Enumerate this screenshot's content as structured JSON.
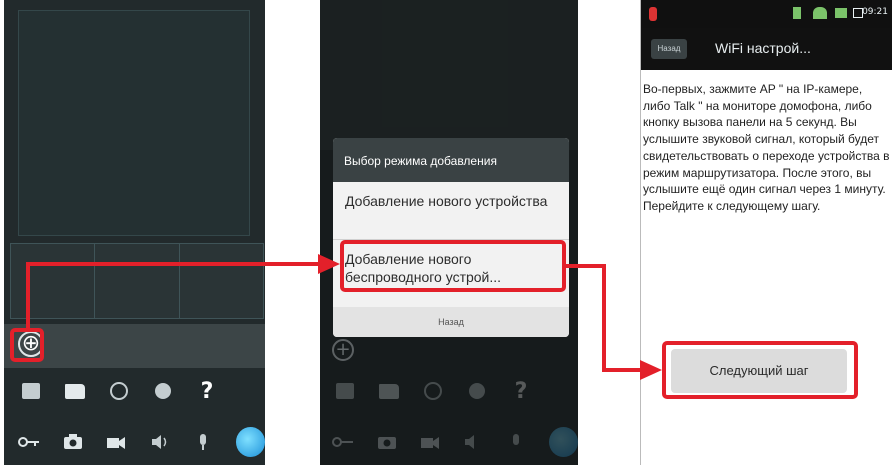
{
  "phone1": {
    "add_glyph": "⊕",
    "help_glyph": "?",
    "toolbar_row1_icons": [
      "list-icon",
      "folder-icon",
      "playback-icon",
      "gear-icon",
      "help-icon"
    ],
    "toolbar_row2_icons": [
      "key-icon",
      "camera-icon",
      "video-icon",
      "speaker-icon",
      "microphone-icon",
      "call-orb-icon"
    ]
  },
  "phone2": {
    "dialog": {
      "title": "Выбор режима добавления",
      "option1": "Добавление нового устройства",
      "option2": "Добавление нового беспроводного устрой...",
      "footer": "Назад"
    },
    "add_glyph": "+",
    "help_glyph": "?"
  },
  "phone3": {
    "status_time": "09:21",
    "back_label": "Назад",
    "title": "WiFi настрой...",
    "instructions": "Во-первых, зажмите AP \" на IP-камере, либо Talk \" на мониторе домофона, либо кнопку вызова панели на 5 секунд. Вы услышите звуковой сигнал, который будет свидетельствовать о переходе устройства в режим маршрутизатора. После этого, вы услышите ещё один сигнал через 1 минуту. Перейдите к следующему шагу.",
    "next_button": "Следующий шаг"
  },
  "colors": {
    "highlight": "#e3202a",
    "app_background": "#222a2c",
    "accent_orb": "#1b8fd8"
  }
}
